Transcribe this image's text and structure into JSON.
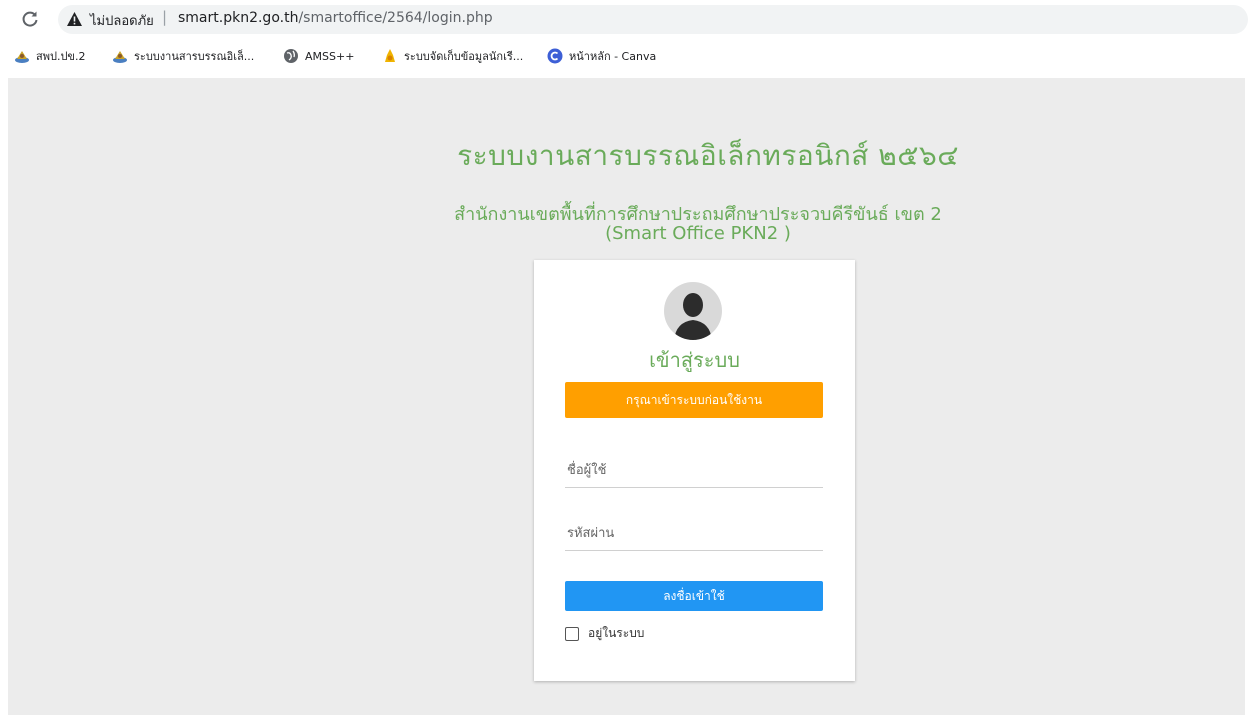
{
  "browser": {
    "security_label": "ไม่ปลอดภัย",
    "url_host": "smart.pkn2.go.th",
    "url_path": "/smartoffice/2564/login.php",
    "bookmarks": [
      {
        "label": "สพป.ปข.2",
        "icon": "school-logo-icon"
      },
      {
        "label": "ระบบงานสารบรรณอิเล็...",
        "icon": "school-logo-icon"
      },
      {
        "label": "AMSS++",
        "icon": "globe-icon"
      },
      {
        "label": "ระบบจัดเก็บข้อมูลนักเรี...",
        "icon": "yellow-seal-icon"
      },
      {
        "label": "หน้าหลัก - Canva",
        "icon": "canva-icon"
      }
    ]
  },
  "page": {
    "title": "ระบบงานสารบรรณอิเล็กทรอนิกส์ ๒๕๖๔",
    "subtitle_line1": "สำนักงานเขตพื้นที่การศึกษาประถมศึกษาประจวบคีรีขันธ์ เขต 2",
    "subtitle_line2": "(Smart Office PKN2 )"
  },
  "login": {
    "heading": "เข้าสู่ระบบ",
    "notice": "กรุณาเข้าระบบก่อนใช้งาน",
    "username_placeholder": "ชื่อผู้ใช้",
    "password_placeholder": "รหัสผ่าน",
    "submit_label": "ลงชื่อเข้าใช้",
    "remember_label": "อยู่ในระบบ"
  },
  "colors": {
    "accent_green": "#6aab5a",
    "notice_orange": "#ff9f00",
    "button_blue": "#2196f3",
    "page_bg": "#ececec"
  }
}
